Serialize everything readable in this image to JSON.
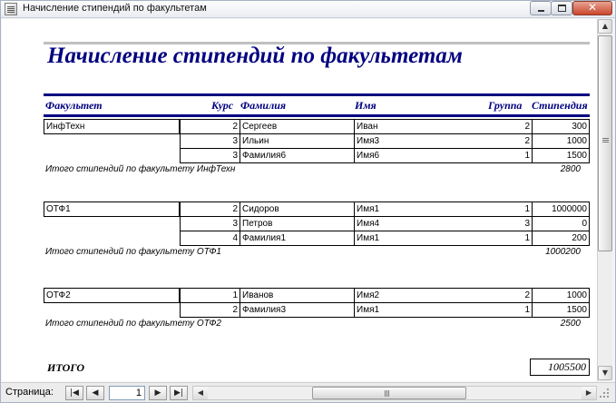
{
  "window": {
    "title": "Начисление стипендий по факультетам",
    "close_glyph": "✕"
  },
  "report": {
    "title": "Начисление стипендий по факультетам",
    "columns": {
      "faculty": "Факультет",
      "course": "Курс",
      "surname": "Фамилия",
      "name": "Имя",
      "group": "Группа",
      "stipend": "Стипендия"
    },
    "groups": [
      {
        "faculty": "ИнфТехн",
        "rows": [
          {
            "course": "2",
            "surname": "Сергеев",
            "name": "Иван",
            "group": "2",
            "stipend": "300"
          },
          {
            "course": "3",
            "surname": "Ильин",
            "name": "Имя3",
            "group": "2",
            "stipend": "1000"
          },
          {
            "course": "3",
            "surname": "Фамилия6",
            "name": "Имя6",
            "group": "1",
            "stipend": "1500"
          }
        ],
        "subtotal_label": "Итого стипендий по факультету ИнфТехн",
        "subtotal": "2800"
      },
      {
        "faculty": "ОТФ1",
        "rows": [
          {
            "course": "2",
            "surname": "Сидоров",
            "name": "Имя1",
            "group": "1",
            "stipend": "1000000"
          },
          {
            "course": "3",
            "surname": "Петров",
            "name": "Имя4",
            "group": "3",
            "stipend": "0"
          },
          {
            "course": "4",
            "surname": "Фамилия1",
            "name": "Имя1",
            "group": "1",
            "stipend": "200"
          }
        ],
        "subtotal_label": "Итого стипендий по факультету ОТФ1",
        "subtotal": "1000200"
      },
      {
        "faculty": "ОТФ2",
        "rows": [
          {
            "course": "1",
            "surname": "Иванов",
            "name": "Имя2",
            "group": "2",
            "stipend": "1000"
          },
          {
            "course": "2",
            "surname": "Фамилия3",
            "name": "Имя1",
            "group": "1",
            "stipend": "1500"
          }
        ],
        "subtotal_label": "Итого стипендий по факультету ОТФ2",
        "subtotal": "2500"
      }
    ],
    "grand_total_label": "ИТОГО",
    "grand_total": "1005500"
  },
  "navigation": {
    "page_label": "Страница:",
    "page_value": "1",
    "first_glyph": "|◀",
    "prev_glyph": "◀",
    "next_glyph": "▶",
    "last_glyph": "▶|"
  },
  "colors": {
    "title_accent": "#000080",
    "rule": "#c0c0c0"
  }
}
